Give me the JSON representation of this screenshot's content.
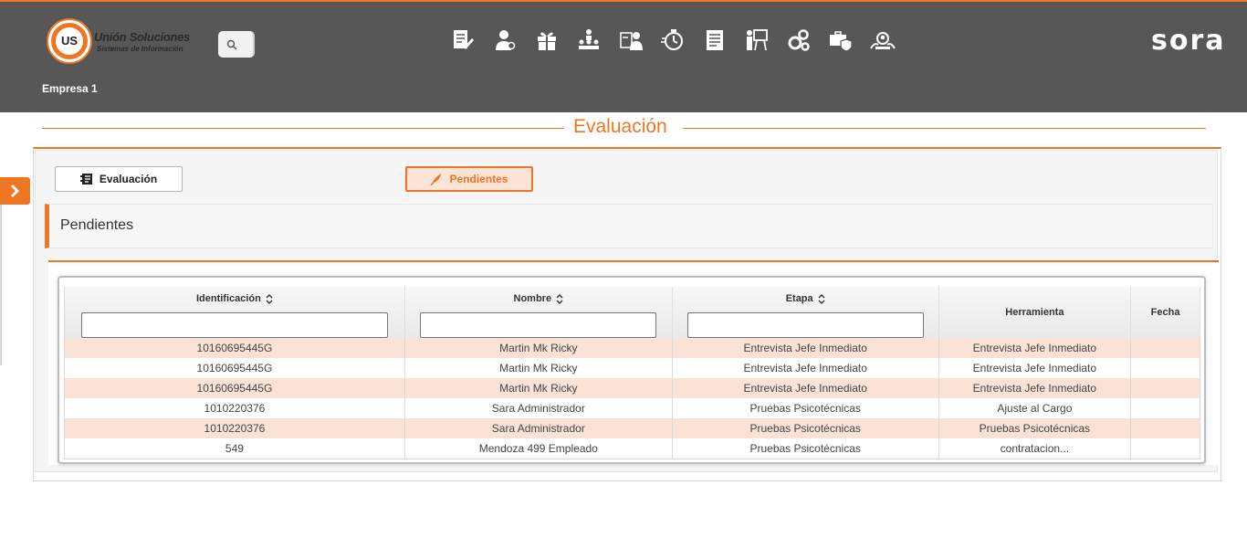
{
  "header": {
    "logo_line1": "Unión Soluciones",
    "logo_line2": "Sistemas de Información",
    "logo_badge": "US",
    "brand": "sora",
    "company": "Empresa 1",
    "accent_color": "#ee7623",
    "icons": [
      "document-edit-icon",
      "person-search-icon",
      "gift-icon",
      "org-hierarchy-icon",
      "person-id-icon",
      "timer-icon",
      "report-list-icon",
      "presentation-icon",
      "gears-icon",
      "briefcase-shield-icon",
      "people-magnify-icon"
    ]
  },
  "page": {
    "title": "Evaluación"
  },
  "tabs": {
    "evaluacion_label": "Evaluación",
    "pendientes_label": "Pendientes"
  },
  "section": {
    "title": "Pendientes"
  },
  "table": {
    "columns": [
      "Identificación",
      "Nombre",
      "Etapa",
      "Herramienta",
      "Fecha"
    ],
    "rows": [
      [
        "10160695445G",
        "Martin Mk Ricky",
        "Entrevista Jefe Inmediato",
        "Entrevista Jefe Inmediato",
        ""
      ],
      [
        "10160695445G",
        "Martin Mk Ricky",
        "Entrevista Jefe Inmediato",
        "Entrevista Jefe Inmediato",
        ""
      ],
      [
        "10160695445G",
        "Martin Mk Ricky",
        "Entrevista Jefe Inmediato",
        "Entrevista Jefe Inmediato",
        ""
      ],
      [
        "1010220376",
        "Sara Administrador",
        "Pruebas Psicotécnicas",
        "Ajuste al Cargo",
        ""
      ],
      [
        "1010220376",
        "Sara Administrador",
        "Pruebas Psicotécnicas",
        "Pruebas Psicotécnicas",
        ""
      ],
      [
        "549",
        "Mendoza 499 Empleado",
        "Pruebas Psicotécnicas",
        "contratacion...",
        ""
      ]
    ]
  }
}
